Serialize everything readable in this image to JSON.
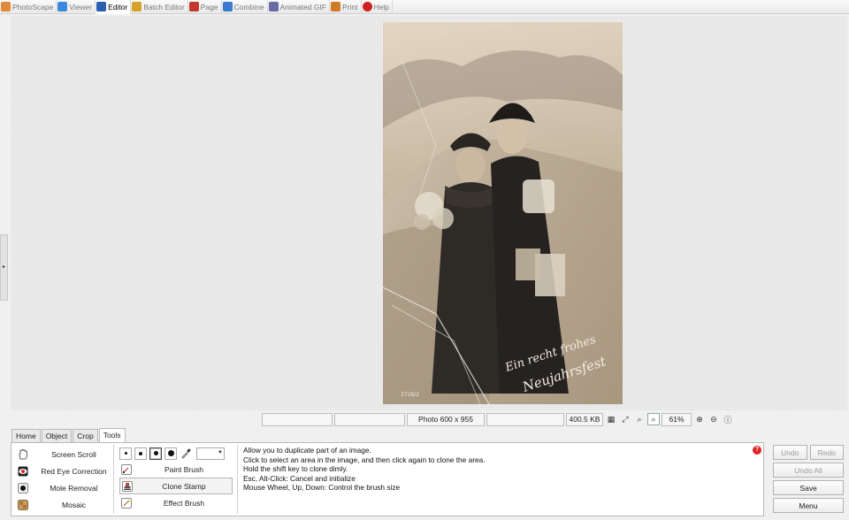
{
  "top_tabs": [
    {
      "label": "PhotoScape",
      "color": "#e08a3c"
    },
    {
      "label": "Viewer",
      "color": "#3c8ae0"
    },
    {
      "label": "Editor",
      "color": "#2a5fb0"
    },
    {
      "label": "Batch Editor",
      "color": "#d6a22a"
    },
    {
      "label": "Page",
      "color": "#c0392b"
    },
    {
      "label": "Combine",
      "color": "#3a7ad0"
    },
    {
      "label": "Animated GIF",
      "color": "#6a6aa8"
    },
    {
      "label": "Print",
      "color": "#d07a2a"
    },
    {
      "label": "Help",
      "color": "#cc2222"
    }
  ],
  "active_top_tab": "Editor",
  "photo_caption": {
    "line1": "Ein recht frohes",
    "line2": "Neujahrsfest",
    "number": "3728/2"
  },
  "status": {
    "photo_size": "Photo 600 x 955",
    "file_size": "400.5 KB",
    "zoom": "61%"
  },
  "lower_tabs": [
    "Home",
    "Object",
    "Crop",
    "Tools"
  ],
  "active_lower_tab": "Tools",
  "tools": [
    {
      "label": "Screen Scroll",
      "icon": "hand-icon"
    },
    {
      "label": "Red Eye Correction",
      "icon": "red-eye-icon"
    },
    {
      "label": "Mole Removal",
      "icon": "mole-icon"
    },
    {
      "label": "Mosaic",
      "icon": "mosaic-icon"
    }
  ],
  "brush_tools": [
    {
      "label": "Paint Brush",
      "icon": "paint-brush-icon"
    },
    {
      "label": "Clone Stamp",
      "icon": "clone-stamp-icon"
    },
    {
      "label": "Effect Brush",
      "icon": "effect-brush-icon"
    }
  ],
  "active_brush_tool": "Clone Stamp",
  "description": [
    "Allow you to duplicate part of an image.",
    "Click to select an area in the image, and then click again to clone the area.",
    "Hold the shift key to clone dimly.",
    "Esc, Alt-Click: Cancel and initialize",
    "Mouse Wheel, Up, Down: Control the brush size"
  ],
  "buttons": {
    "undo": "Undo",
    "redo": "Redo",
    "undo_all": "Undo All",
    "save": "Save",
    "menu": "Menu"
  }
}
